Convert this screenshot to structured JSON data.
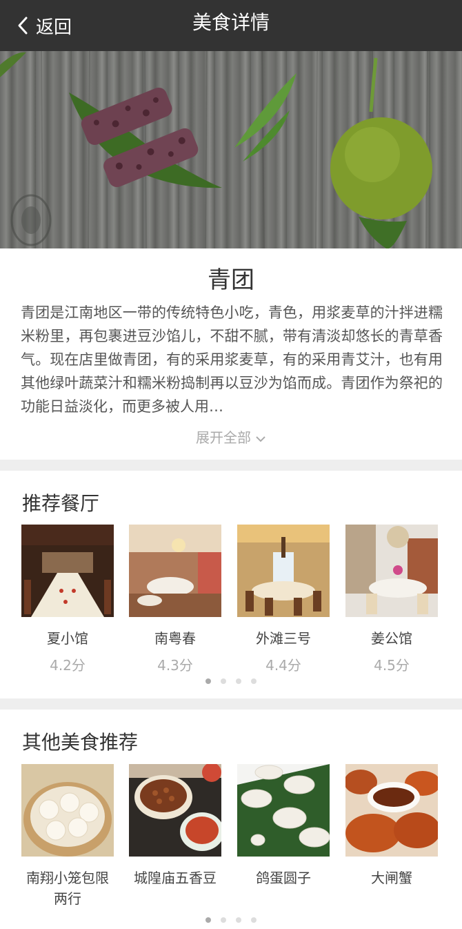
{
  "nav": {
    "back_label": "返回",
    "title": "美食详情"
  },
  "food": {
    "name": "青团",
    "description": "青团是江南地区一带的传统特色小吃，青色，用浆麦草的汁拌进糯米粉里，再包裹进豆沙馅儿，不甜不腻，带有清淡却悠长的青草香气。现在店里做青团，有的采用浆麦草，有的采用青艾汁，也有用其他绿叶蔬菜汁和糯米粉捣制再以豆沙为馅而成。青团作为祭祀的功能日益淡化，而更多被人用…",
    "expand_label": "展开全部"
  },
  "restaurants": {
    "title": "推荐餐厅",
    "items": [
      {
        "name": "夏小馆",
        "score": "4.2分"
      },
      {
        "name": "南粤春",
        "score": "4.3分"
      },
      {
        "name": "外滩三号",
        "score": "4.4分"
      },
      {
        "name": "姜公馆",
        "score": "4.5分"
      }
    ]
  },
  "other_foods": {
    "title": "其他美食推荐",
    "items": [
      {
        "name": "南翔小笼包限两行"
      },
      {
        "name": "城隍庙五香豆"
      },
      {
        "name": "鸽蛋圆子"
      },
      {
        "name": "大闸蟹"
      }
    ]
  },
  "icons": {
    "back": "chevron-left-icon",
    "expand": "chevron-down-icon"
  },
  "colors": {
    "nav_bg": "#333333",
    "separator": "#eeeeee",
    "muted_text": "#aaaaaa",
    "dot_active": "#aaaaaa",
    "dot_inactive": "#dddddd"
  }
}
